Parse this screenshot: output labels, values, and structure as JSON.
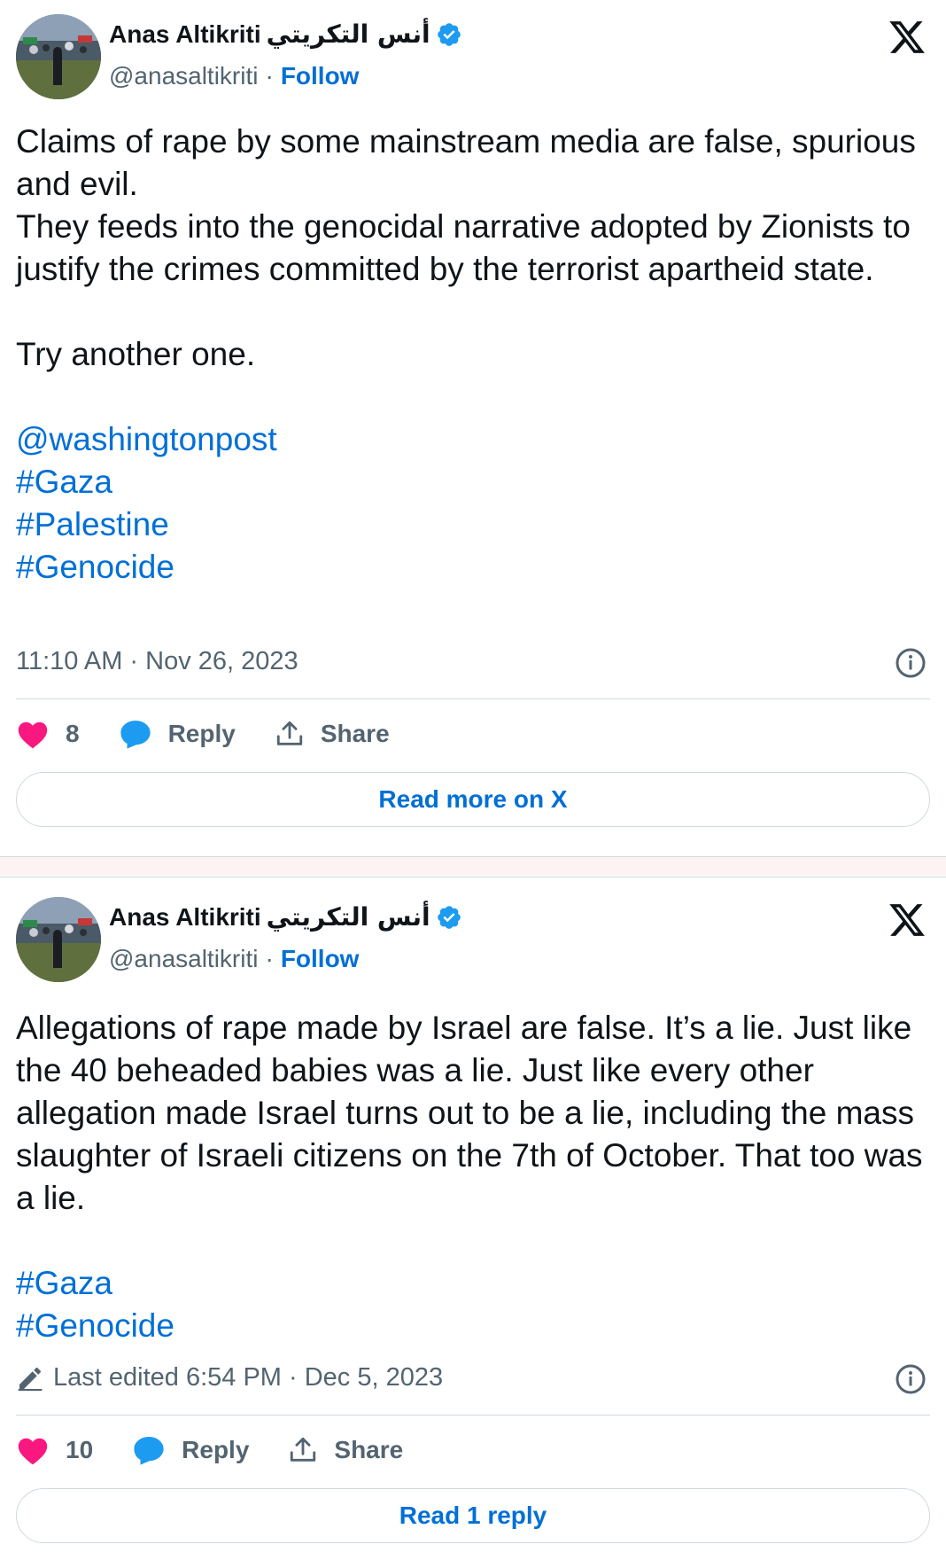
{
  "tweets": [
    {
      "author": {
        "name": "Anas Altikriti",
        "arabic_name": "أنس التكريتي",
        "handle": "@anasaltikriti",
        "separator": "·",
        "follow_label": "Follow"
      },
      "body": [
        "Claims of rape by some mainstream media are false, spurious and evil.",
        "They feeds into the genocidal narrative adopted by Zionists to justify the crimes committed by the terrorist apartheid state."
      ],
      "body2": "Try another one.",
      "tags": [
        "@washingtonpost",
        "#Gaza",
        "#Palestine",
        "#Genocide"
      ],
      "timestamp": "11:10 AM · Nov 26, 2023",
      "likes": "8",
      "reply_label": "Reply",
      "share_label": "Share",
      "cta_label": "Read more on X"
    },
    {
      "author": {
        "name": "Anas Altikriti",
        "arabic_name": "أنس التكريتي",
        "handle": "@anasaltikriti",
        "separator": "·",
        "follow_label": "Follow"
      },
      "body": [
        "Allegations of rape made by Israel are false. It’s a lie. Just like the 40 beheaded babies was a lie. Just like every other allegation made Israel turns out to be a lie, including the mass slaughter of Israeli citizens on the 7th of October. That too was a lie."
      ],
      "tags": [
        "#Gaza",
        "#Genocide"
      ],
      "timestamp": "Last edited 6:54 PM · Dec 5, 2023",
      "likes": "10",
      "reply_label": "Reply",
      "share_label": "Share",
      "cta_label": "Read 1 reply"
    }
  ],
  "colors": {
    "link": "#006fd6",
    "muted": "#536471",
    "heart": "#f91880",
    "reply_bubble": "#1d9bf0",
    "verified": "#1d9bf0"
  },
  "icons": [
    "verified-badge-icon",
    "x-logo-icon",
    "info-icon",
    "heart-icon",
    "reply-bubble-icon",
    "share-icon",
    "edit-pencil-icon"
  ]
}
